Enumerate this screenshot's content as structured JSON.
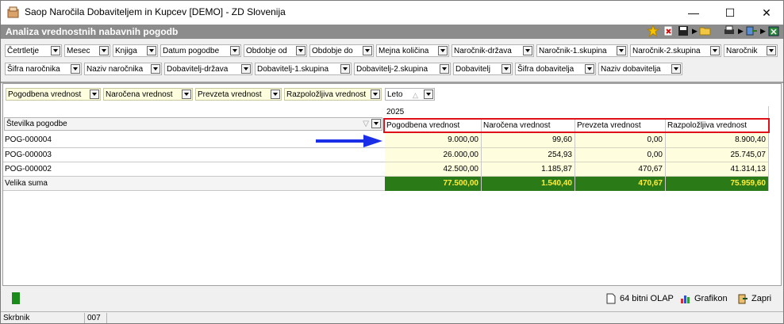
{
  "window": {
    "title": "Saop Naročila Dobaviteljem in Kupcev [DEMO] - ZD Slovenija",
    "minimize": "—",
    "maximize": "☐",
    "close": "✕"
  },
  "header": {
    "title": "Analiza vrednostnih nabavnih pogodb"
  },
  "filter_fields": [
    "Četrtletje",
    "Mesec",
    "Knjiga",
    "Datum pogodbe",
    "Obdobje od",
    "Obdobje do",
    "Mejna količina",
    "Naročnik-država",
    "Naročnik-1.skupina",
    "Naročnik-2.skupina",
    "Naročnik",
    "Šifra naročnika",
    "Naziv naročnika",
    "Dobavitelj-država",
    "Dobavitelj-1.skupina",
    "Dobavitelj-2.skupina",
    "Dobavitelj",
    "Šifra dobavitelja",
    "Naziv dobavitelja"
  ],
  "data_fields": [
    "Pogodbena vrednost",
    "Naročena vrednost",
    "Prevzeta vrednost",
    "Razpoložljiva vrednost"
  ],
  "column_field": "Leto",
  "row_field": "Številka pogodbe",
  "year": "2025",
  "columns": [
    "Pogodbena vrednost",
    "Naročena vrednost",
    "Prevzeta vrednost",
    "Razpoložljiva vrednost"
  ],
  "rows": [
    {
      "label": "POG-000004",
      "values": [
        "9.000,00",
        "99,60",
        "0,00",
        "8.900,40"
      ]
    },
    {
      "label": "POG-000003",
      "values": [
        "26.000,00",
        "254,93",
        "0,00",
        "25.745,07"
      ]
    },
    {
      "label": "POG-000002",
      "values": [
        "42.500,00",
        "1.185,87",
        "470,67",
        "41.314,13"
      ]
    }
  ],
  "total": {
    "label": "Velika suma",
    "values": [
      "77.500,00",
      "1.540,40",
      "470,67",
      "75.959,60"
    ]
  },
  "bottom_buttons": {
    "olap": "64 bitni OLAP",
    "chart": "Grafikon",
    "close": "Zapri"
  },
  "status": {
    "user": "Skrbnik",
    "code": "007"
  },
  "colors": {
    "highlight_border": "#e0101a",
    "arrow": "#1a2ee8",
    "total_bg": "#2b7a18",
    "total_text": "#ffef3a"
  }
}
